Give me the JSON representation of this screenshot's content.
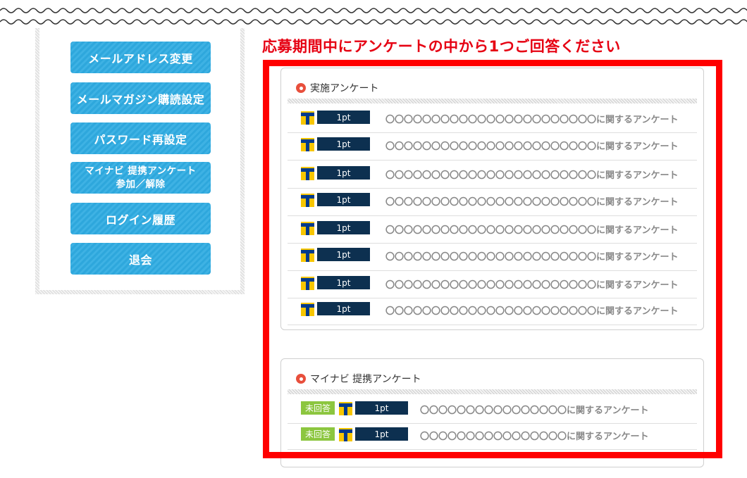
{
  "sidebar": {
    "items": [
      {
        "label": "メールアドレス変更"
      },
      {
        "label": "メールマガジン購読設定"
      },
      {
        "label": "パスワード再設定"
      },
      {
        "label": "マイナビ 提携アンケート\n参加／解除"
      },
      {
        "label": "ログイン履歴"
      },
      {
        "label": "退会"
      }
    ]
  },
  "headline": "応募期間中にアンケートの中から1つご回答ください",
  "section1": {
    "title": "実施アンケート",
    "rows": [
      {
        "points": "1pt",
        "title": "〇〇〇〇〇〇〇〇〇〇〇〇〇〇〇〇〇〇〇〇〇〇〇に関するアンケート"
      },
      {
        "points": "1pt",
        "title": "〇〇〇〇〇〇〇〇〇〇〇〇〇〇〇〇〇〇〇〇〇〇〇に関するアンケート"
      },
      {
        "points": "1pt",
        "title": "〇〇〇〇〇〇〇〇〇〇〇〇〇〇〇〇〇〇〇〇〇〇〇に関するアンケート"
      },
      {
        "points": "1pt",
        "title": "〇〇〇〇〇〇〇〇〇〇〇〇〇〇〇〇〇〇〇〇〇〇〇に関するアンケート"
      },
      {
        "points": "1pt",
        "title": "〇〇〇〇〇〇〇〇〇〇〇〇〇〇〇〇〇〇〇〇〇〇〇に関するアンケート"
      },
      {
        "points": "1pt",
        "title": "〇〇〇〇〇〇〇〇〇〇〇〇〇〇〇〇〇〇〇〇〇〇〇に関するアンケート"
      },
      {
        "points": "1pt",
        "title": "〇〇〇〇〇〇〇〇〇〇〇〇〇〇〇〇〇〇〇〇〇〇〇に関するアンケート"
      },
      {
        "points": "1pt",
        "title": "〇〇〇〇〇〇〇〇〇〇〇〇〇〇〇〇〇〇〇〇〇〇〇に関するアンケート"
      }
    ]
  },
  "section2": {
    "title": "マイナビ 提携アンケート",
    "rows": [
      {
        "status": "未回答",
        "points": "1pt",
        "title": "〇〇〇〇〇〇〇〇〇〇〇〇〇〇〇〇に関するアンケート"
      },
      {
        "status": "未回答",
        "points": "1pt",
        "title": "〇〇〇〇〇〇〇〇〇〇〇〇〇〇〇〇に関するアンケート"
      }
    ]
  },
  "colors": {
    "accent_blue": "#2ea7dc",
    "headline_red": "#e60012",
    "frame_red": "#ff0000",
    "points_navy": "#0d3050",
    "badge_green": "#8cc63f",
    "tpoint_yellow": "#f7c600"
  },
  "icons": {
    "wave": "wave-divider-icon",
    "section_marker": "circle-dot-icon",
    "points_brand": "t-point-icon"
  }
}
